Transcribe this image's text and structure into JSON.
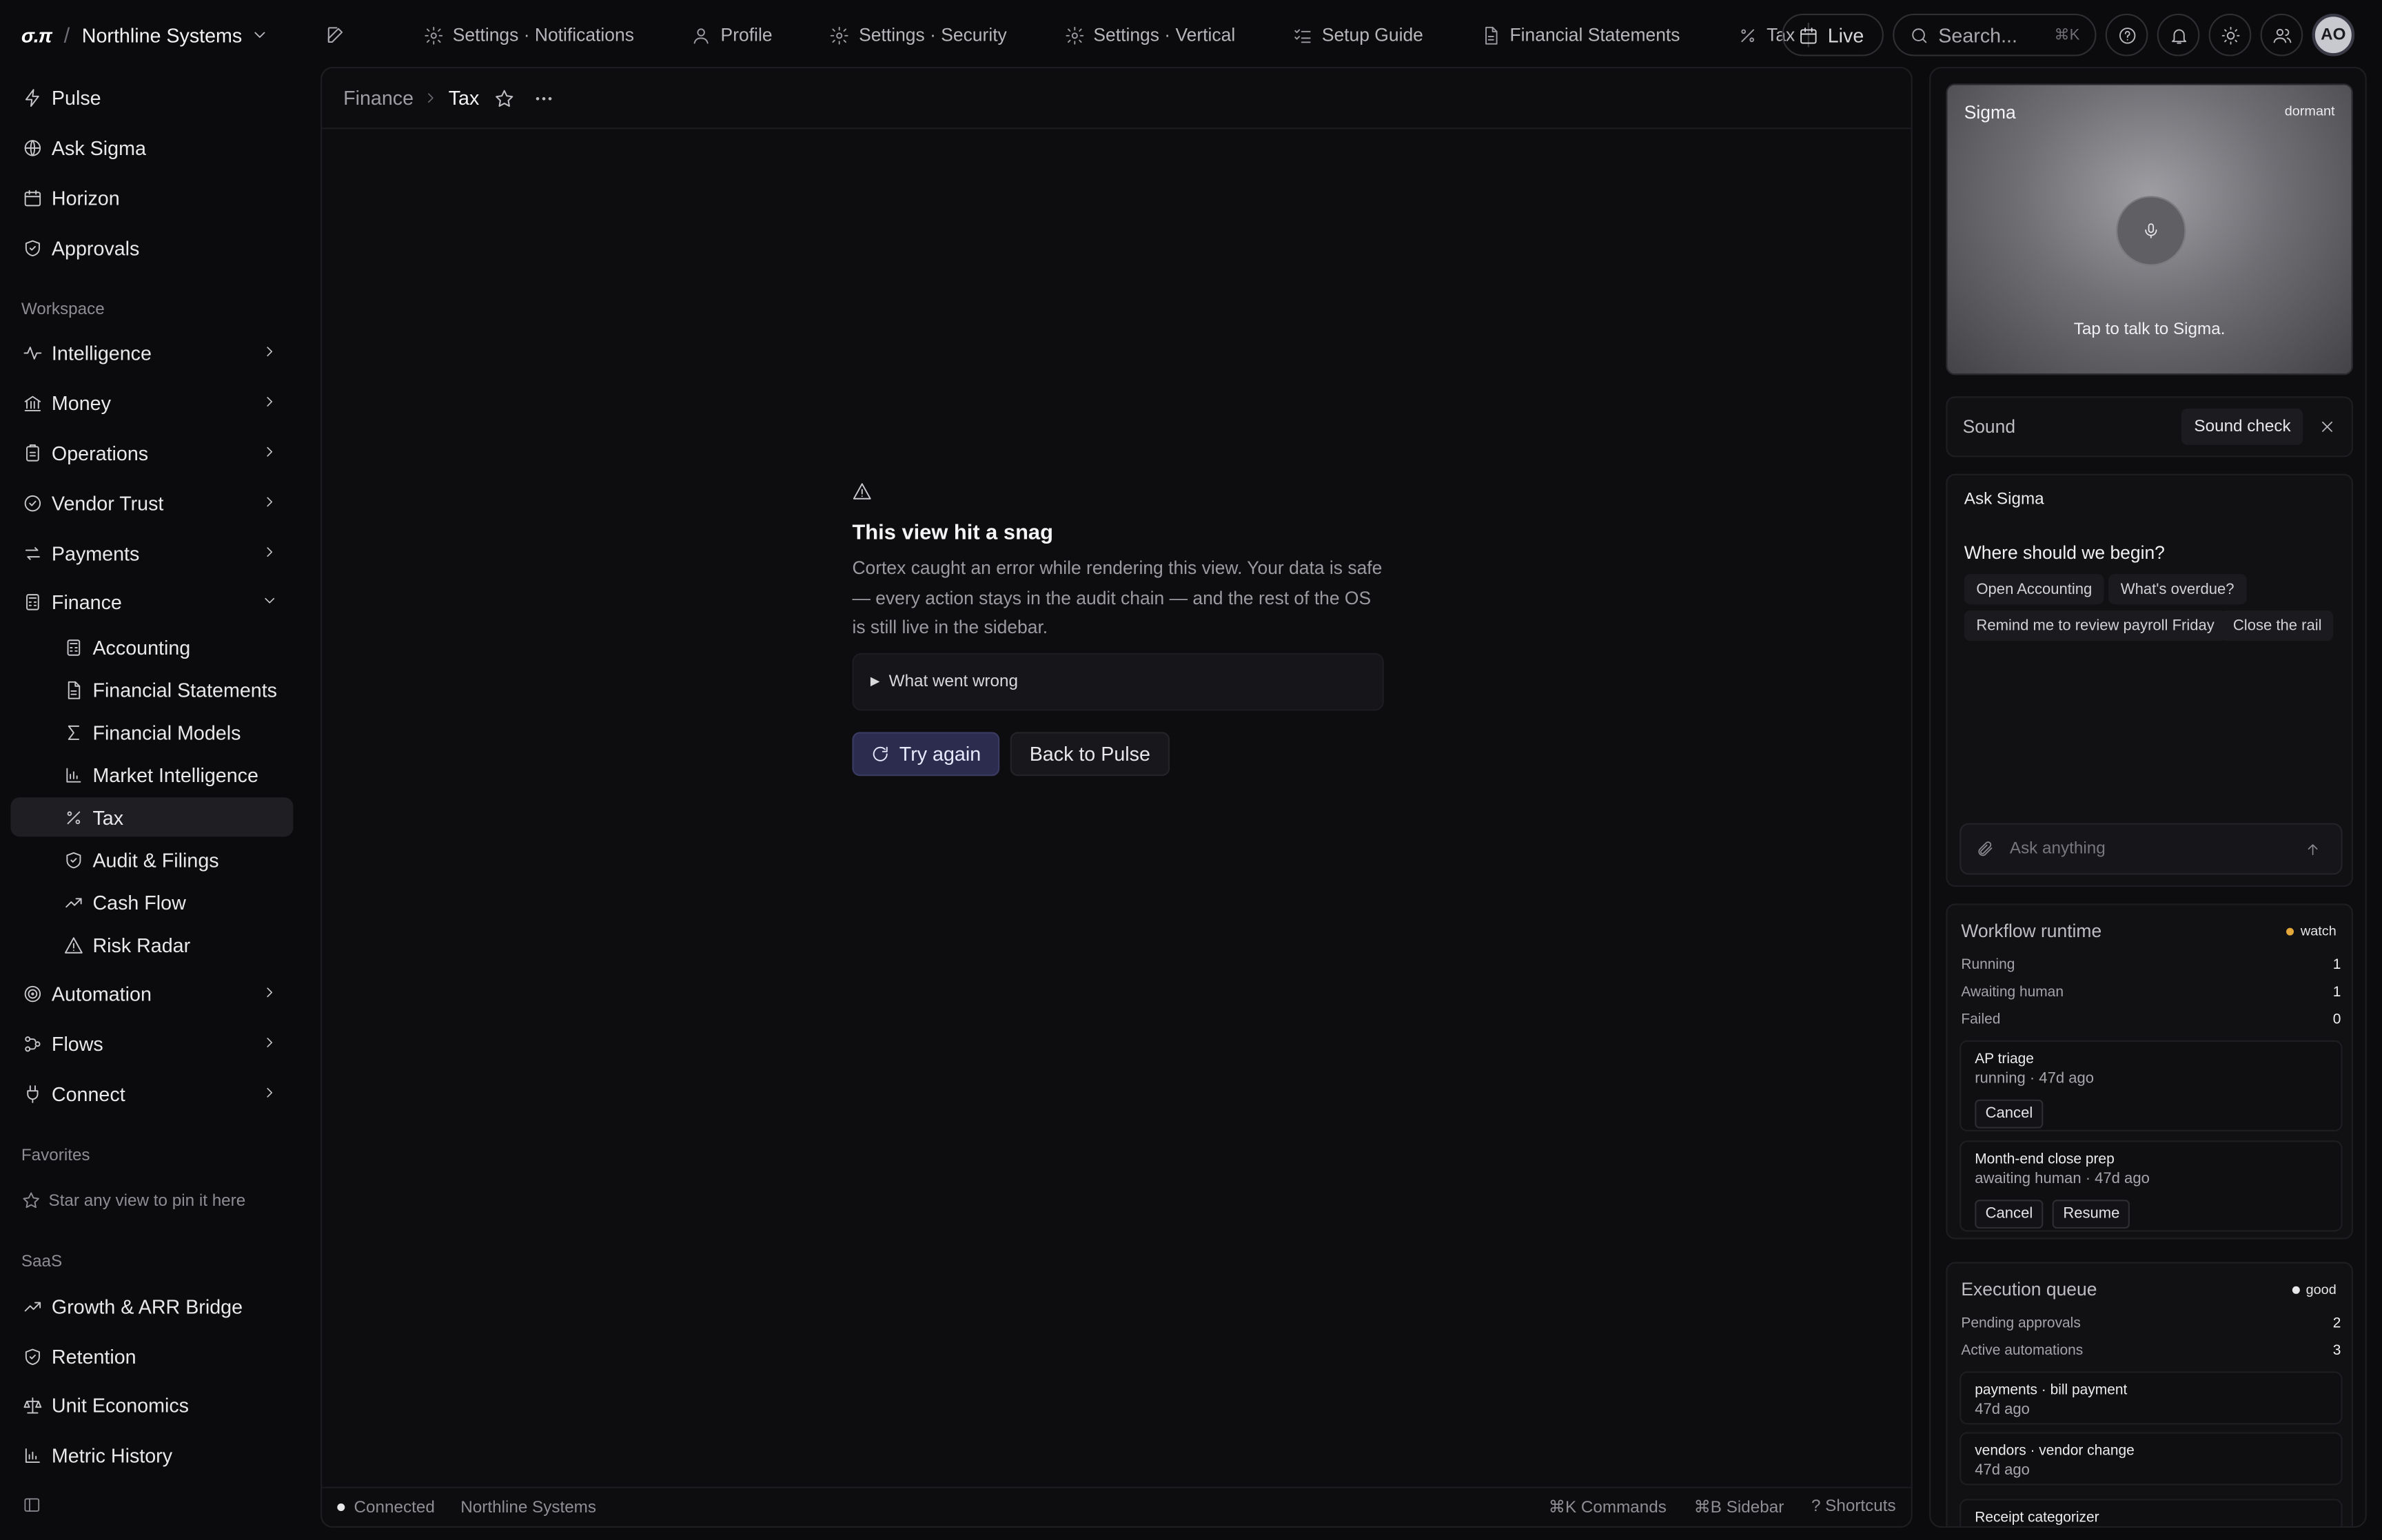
{
  "app": {
    "logo": "σ.π",
    "org_name": "Northline Systems"
  },
  "tabs": [
    {
      "label": "Settings · Notifications",
      "icon": "gear-icon"
    },
    {
      "label": "Profile",
      "icon": "user-icon"
    },
    {
      "label": "Settings · Security",
      "icon": "gear-icon"
    },
    {
      "label": "Settings · Vertical",
      "icon": "gear-icon"
    },
    {
      "label": "Setup Guide",
      "icon": "checklist-icon"
    },
    {
      "label": "Financial Statements",
      "icon": "document-icon"
    },
    {
      "label": "Tax",
      "icon": "percent-icon"
    }
  ],
  "header_controls": {
    "live_label": "Live",
    "search_placeholder": "Search...",
    "search_shortcut": "⌘K",
    "avatar_initials": "AO"
  },
  "sidebar": {
    "top_items": [
      {
        "label": "Pulse",
        "icon": "bolt-icon"
      },
      {
        "label": "Ask Sigma",
        "icon": "globe-icon"
      },
      {
        "label": "Horizon",
        "icon": "calendar-icon"
      },
      {
        "label": "Approvals",
        "icon": "shield-check-icon"
      }
    ],
    "workspace_label": "Workspace",
    "workspace_items": [
      {
        "label": "Intelligence",
        "icon": "pulse-line-icon"
      },
      {
        "label": "Money",
        "icon": "bank-icon"
      },
      {
        "label": "Operations",
        "icon": "clipboard-icon"
      },
      {
        "label": "Vendor Trust",
        "icon": "badge-check-icon"
      },
      {
        "label": "Payments",
        "icon": "arrows-icon"
      },
      {
        "label": "Finance",
        "icon": "calculator-icon"
      }
    ],
    "finance_subitems": [
      {
        "label": "Accounting",
        "icon": "calculator-icon"
      },
      {
        "label": "Financial Statements",
        "icon": "document-icon"
      },
      {
        "label": "Financial Models",
        "icon": "sigma-icon"
      },
      {
        "label": "Market Intelligence",
        "icon": "bar-chart-icon"
      },
      {
        "label": "Tax",
        "icon": "percent-icon"
      },
      {
        "label": "Audit & Filings",
        "icon": "shield-check-icon"
      },
      {
        "label": "Cash Flow",
        "icon": "trend-up-icon"
      },
      {
        "label": "Risk Radar",
        "icon": "warning-icon"
      }
    ],
    "bottom_workspace_items": [
      {
        "label": "Automation",
        "icon": "target-icon"
      },
      {
        "label": "Flows",
        "icon": "flows-icon"
      },
      {
        "label": "Connect",
        "icon": "plug-icon"
      }
    ],
    "favorites_label": "Favorites",
    "favorites_hint": "Star any view to pin it here",
    "saas_label": "SaaS",
    "saas_items": [
      {
        "label": "Growth & ARR Bridge",
        "icon": "trend-up-icon"
      },
      {
        "label": "Retention",
        "icon": "shield-check-icon"
      },
      {
        "label": "Unit Economics",
        "icon": "scale-icon"
      },
      {
        "label": "Metric History",
        "icon": "bar-chart-icon"
      }
    ]
  },
  "main": {
    "breadcrumb_parent": "Finance",
    "breadcrumb_current": "Tax",
    "error": {
      "title": "This view hit a snag",
      "body": "Cortex caught an error while rendering this view. Your data is safe — every action stays in the audit chain — and the rest of the OS is still live in the sidebar.",
      "details_label": "What went wrong",
      "retry_label": "Try again",
      "back_label": "Back to Pulse"
    },
    "status": {
      "connection": "Connected",
      "org": "Northline Systems",
      "hints": [
        "⌘K Commands",
        "⌘B Sidebar",
        "? Shortcuts"
      ]
    }
  },
  "rail": {
    "hero": {
      "title": "Sigma",
      "state": "dormant",
      "caption": "Tap to talk to Sigma."
    },
    "sound": {
      "label": "Sound",
      "check_label": "Sound check"
    },
    "ask": {
      "title": "Ask Sigma",
      "question": "Where should we begin?",
      "chips": [
        "Open Accounting",
        "What's overdue?",
        "Remind me to review payroll Friday",
        "Close the rail"
      ],
      "placeholder": "Ask anything"
    },
    "workflow": {
      "title": "Workflow runtime",
      "badge": "watch",
      "badge_color": "#e3a73b",
      "stats": [
        {
          "label": "Running",
          "value": "1"
        },
        {
          "label": "Awaiting human",
          "value": "1"
        },
        {
          "label": "Failed",
          "value": "0"
        }
      ],
      "jobs": [
        {
          "name": "AP triage",
          "meta": "running · 47d ago",
          "actions": [
            "Cancel"
          ]
        },
        {
          "name": "Month-end close prep",
          "meta": "awaiting human · 47d ago",
          "actions": [
            "Cancel",
            "Resume"
          ]
        }
      ]
    },
    "queue": {
      "title": "Execution queue",
      "badge": "good",
      "badge_color": "#e8e8ea",
      "stats": [
        {
          "label": "Pending approvals",
          "value": "2"
        },
        {
          "label": "Active automations",
          "value": "3"
        }
      ],
      "items": [
        {
          "name": "payments · bill payment",
          "meta": "47d ago"
        },
        {
          "name": "vendors · vendor change",
          "meta": "47d ago"
        },
        {
          "name": "Receipt categorizer",
          "meta": ""
        }
      ]
    }
  }
}
